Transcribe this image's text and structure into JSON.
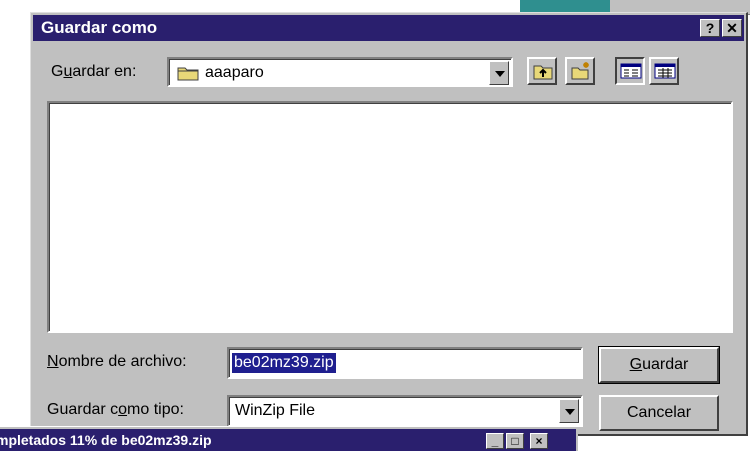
{
  "dialog": {
    "title": "Guardar como",
    "help_label": "?",
    "close_label": "✕"
  },
  "save_in": {
    "label_pre": "G",
    "label_u": "u",
    "label_post": "ardar en:",
    "value": "aaaparo"
  },
  "file_name": {
    "label_u": "N",
    "label_post": "ombre de archivo:",
    "value": "be02mz39.zip"
  },
  "file_type": {
    "label_pre": "Guardar c",
    "label_u": "o",
    "label_post": "mo tipo:",
    "value": "WinZip File"
  },
  "buttons": {
    "save_u": "G",
    "save_post": "uardar",
    "cancel": "Cancelar"
  },
  "progress_window": {
    "title": "mpletados 11% de be02mz39.zip"
  },
  "colors": {
    "titlebar": "#2a1f6e",
    "face": "#c0c0c0",
    "selection": "#1f1f8f"
  },
  "icons": [
    "folder-icon",
    "up-folder-icon",
    "new-folder-icon",
    "list-view-icon",
    "details-view-icon",
    "chevron-down-icon"
  ]
}
